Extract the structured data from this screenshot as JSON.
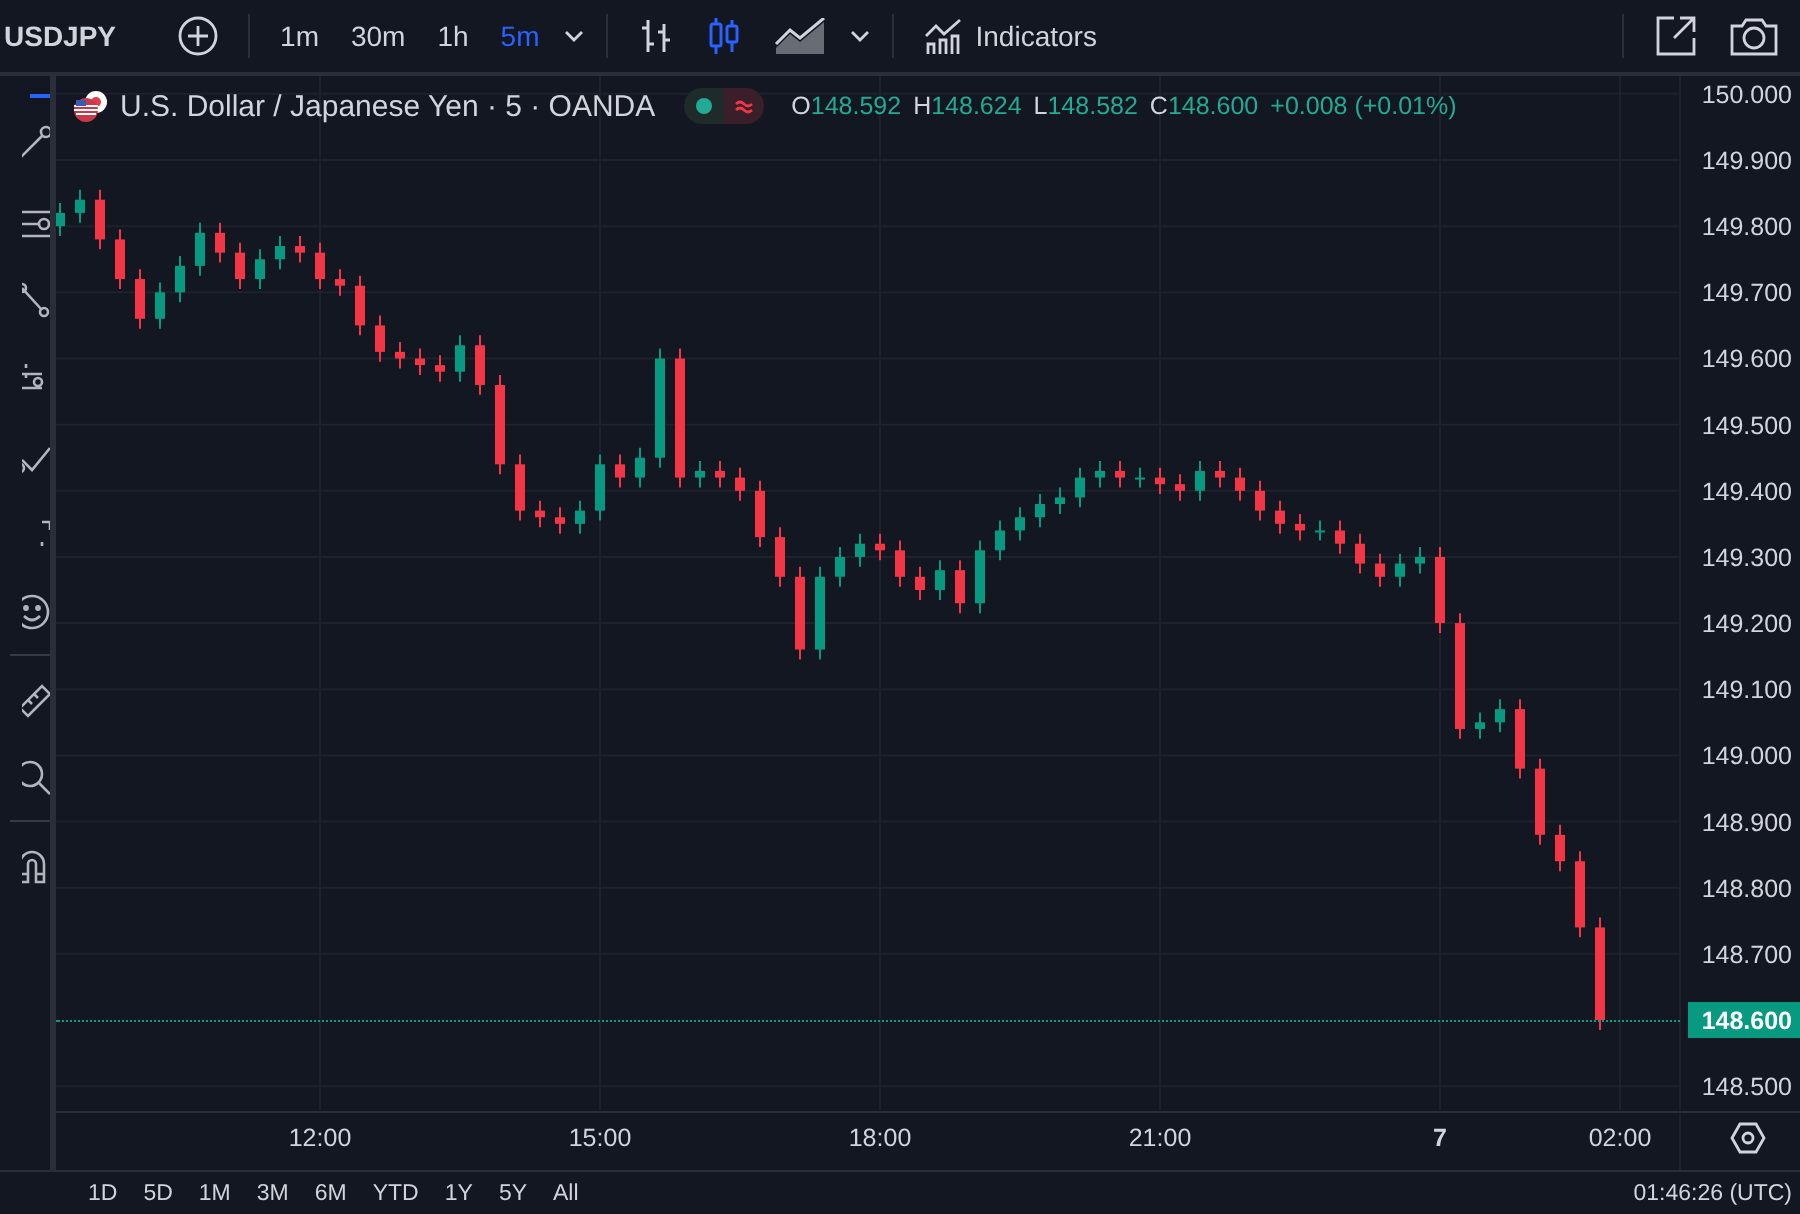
{
  "toolbar": {
    "symbol": "USDJPY",
    "intervals": [
      {
        "label": "1m",
        "selected": false
      },
      {
        "label": "30m",
        "selected": false
      },
      {
        "label": "1h",
        "selected": false
      },
      {
        "label": "5m",
        "selected": true
      }
    ],
    "chart_styles": [
      {
        "kind": "bars",
        "selected": false
      },
      {
        "kind": "candles",
        "selected": true
      },
      {
        "kind": "area",
        "selected": false
      }
    ],
    "indicators": "Indicators"
  },
  "legend": {
    "title": "U.S. Dollar / Japanese Yen · 5 · OANDA",
    "ohlc": [
      {
        "label": "O",
        "value": "148.592"
      },
      {
        "label": "H",
        "value": "148.624"
      },
      {
        "label": "L",
        "value": "148.582"
      },
      {
        "label": "C",
        "value": "148.600"
      }
    ],
    "change": "+0.008 (+0.01%)"
  },
  "chart": {
    "last_price": "148.600",
    "chart_data": {
      "type": "candlestick",
      "grid": true,
      "ylim": [
        148.464,
        150.027
      ],
      "yticks": [
        {
          "value": 148.5,
          "label": "148.500"
        },
        {
          "value": 148.7,
          "label": "148.700"
        },
        {
          "value": 148.8,
          "label": "148.800"
        },
        {
          "value": 148.9,
          "label": "148.900"
        },
        {
          "value": 149.0,
          "label": "149.000"
        },
        {
          "value": 149.1,
          "label": "149.100"
        },
        {
          "value": 149.2,
          "label": "149.200"
        },
        {
          "value": 149.3,
          "label": "149.300"
        },
        {
          "value": 149.4,
          "label": "149.400"
        },
        {
          "value": 149.5,
          "label": "149.500"
        },
        {
          "value": 149.6,
          "label": "149.600"
        },
        {
          "value": 149.7,
          "label": "149.700"
        },
        {
          "value": 149.8,
          "label": "149.800"
        },
        {
          "value": 149.9,
          "label": "149.900"
        },
        {
          "value": 150.0,
          "label": "150.000"
        }
      ],
      "categories": [
        null,
        null,
        null,
        null,
        null,
        null,
        null,
        null,
        null,
        null,
        null,
        null,
        null,
        "12:00",
        null,
        null,
        null,
        null,
        null,
        null,
        null,
        null,
        null,
        null,
        null,
        null,
        null,
        "15:00",
        null,
        null,
        null,
        null,
        null,
        null,
        null,
        null,
        null,
        null,
        null,
        null,
        null,
        "18:00",
        null,
        null,
        null,
        null,
        null,
        null,
        null,
        null,
        null,
        null,
        null,
        null,
        null,
        "21:00",
        null,
        null,
        null,
        null,
        null,
        null,
        null,
        null,
        null,
        null,
        null,
        null,
        null,
        "7",
        null,
        null,
        null,
        null,
        null,
        null,
        null,
        null,
        "02:00"
      ],
      "ohlc": [
        [
          149.8,
          149.835,
          149.785,
          149.82
        ],
        [
          149.82,
          149.855,
          149.805,
          149.84
        ],
        [
          149.84,
          149.855,
          149.765,
          149.78
        ],
        [
          149.78,
          149.795,
          149.705,
          149.72
        ],
        [
          149.72,
          149.735,
          149.645,
          149.66
        ],
        [
          149.66,
          149.715,
          149.645,
          149.7
        ],
        [
          149.7,
          149.755,
          149.685,
          149.74
        ],
        [
          149.74,
          149.805,
          149.725,
          149.79
        ],
        [
          149.79,
          149.805,
          149.745,
          149.76
        ],
        [
          149.76,
          149.775,
          149.705,
          149.72
        ],
        [
          149.72,
          149.765,
          149.705,
          149.75
        ],
        [
          149.75,
          149.785,
          149.735,
          149.77
        ],
        [
          149.77,
          149.785,
          149.745,
          149.76
        ],
        [
          149.76,
          149.775,
          149.705,
          149.72
        ],
        [
          149.72,
          149.735,
          149.695,
          149.71
        ],
        [
          149.71,
          149.725,
          149.635,
          149.65
        ],
        [
          149.65,
          149.665,
          149.595,
          149.61
        ],
        [
          149.61,
          149.625,
          149.585,
          149.6
        ],
        [
          149.6,
          149.615,
          149.575,
          149.59
        ],
        [
          149.59,
          149.605,
          149.565,
          149.58
        ],
        [
          149.58,
          149.635,
          149.565,
          149.62
        ],
        [
          149.62,
          149.635,
          149.545,
          149.56
        ],
        [
          149.56,
          149.575,
          149.425,
          149.44
        ],
        [
          149.44,
          149.455,
          149.355,
          149.37
        ],
        [
          149.37,
          149.385,
          149.345,
          149.36
        ],
        [
          149.36,
          149.375,
          149.335,
          149.35
        ],
        [
          149.35,
          149.385,
          149.335,
          149.37
        ],
        [
          149.37,
          149.455,
          149.355,
          149.44
        ],
        [
          149.44,
          149.455,
          149.405,
          149.42
        ],
        [
          149.42,
          149.465,
          149.405,
          149.45
        ],
        [
          149.45,
          149.615,
          149.435,
          149.6
        ],
        [
          149.6,
          149.615,
          149.405,
          149.42
        ],
        [
          149.42,
          149.445,
          149.405,
          149.43
        ],
        [
          149.43,
          149.445,
          149.405,
          149.42
        ],
        [
          149.42,
          149.435,
          149.385,
          149.4
        ],
        [
          149.4,
          149.415,
          149.315,
          149.33
        ],
        [
          149.33,
          149.345,
          149.255,
          149.27
        ],
        [
          149.27,
          149.285,
          149.145,
          149.16
        ],
        [
          149.16,
          149.285,
          149.145,
          149.27
        ],
        [
          149.27,
          149.315,
          149.255,
          149.3
        ],
        [
          149.3,
          149.335,
          149.285,
          149.32
        ],
        [
          149.32,
          149.335,
          149.295,
          149.31
        ],
        [
          149.31,
          149.325,
          149.255,
          149.27
        ],
        [
          149.27,
          149.285,
          149.235,
          149.25
        ],
        [
          149.25,
          149.295,
          149.235,
          149.28
        ],
        [
          149.28,
          149.295,
          149.215,
          149.23
        ],
        [
          149.23,
          149.325,
          149.215,
          149.31
        ],
        [
          149.31,
          149.355,
          149.295,
          149.34
        ],
        [
          149.34,
          149.375,
          149.325,
          149.36
        ],
        [
          149.36,
          149.395,
          149.345,
          149.38
        ],
        [
          149.38,
          149.405,
          149.365,
          149.39
        ],
        [
          149.39,
          149.435,
          149.375,
          149.42
        ],
        [
          149.42,
          149.445,
          149.405,
          149.43
        ],
        [
          149.43,
          149.445,
          149.405,
          149.42
        ],
        [
          149.42,
          149.435,
          149.405,
          149.42
        ],
        [
          149.42,
          149.435,
          149.395,
          149.41
        ],
        [
          149.41,
          149.425,
          149.385,
          149.4
        ],
        [
          149.4,
          149.445,
          149.385,
          149.43
        ],
        [
          149.43,
          149.445,
          149.405,
          149.42
        ],
        [
          149.42,
          149.435,
          149.385,
          149.4
        ],
        [
          149.4,
          149.415,
          149.355,
          149.37
        ],
        [
          149.37,
          149.385,
          149.335,
          149.35
        ],
        [
          149.35,
          149.365,
          149.325,
          149.34
        ],
        [
          149.34,
          149.355,
          149.325,
          149.34
        ],
        [
          149.34,
          149.355,
          149.305,
          149.32
        ],
        [
          149.32,
          149.335,
          149.275,
          149.29
        ],
        [
          149.29,
          149.305,
          149.255,
          149.27
        ],
        [
          149.27,
          149.305,
          149.255,
          149.29
        ],
        [
          149.29,
          149.315,
          149.275,
          149.3
        ],
        [
          149.3,
          149.315,
          149.185,
          149.2
        ],
        [
          149.2,
          149.215,
          149.025,
          149.04
        ],
        [
          149.04,
          149.065,
          149.025,
          149.05
        ],
        [
          149.05,
          149.085,
          149.035,
          149.07
        ],
        [
          149.07,
          149.085,
          148.965,
          148.98
        ],
        [
          148.98,
          148.995,
          148.865,
          148.88
        ],
        [
          148.88,
          148.895,
          148.825,
          148.84
        ],
        [
          148.84,
          148.855,
          148.725,
          148.74
        ],
        [
          148.74,
          148.755,
          148.585,
          148.6
        ],
        null
      ]
    }
  },
  "bottom_bar": {
    "ranges": [
      "1D",
      "5D",
      "1M",
      "3M",
      "6M",
      "YTD",
      "1Y",
      "5Y",
      "All"
    ],
    "clock": "01:46:26 (UTC)"
  }
}
